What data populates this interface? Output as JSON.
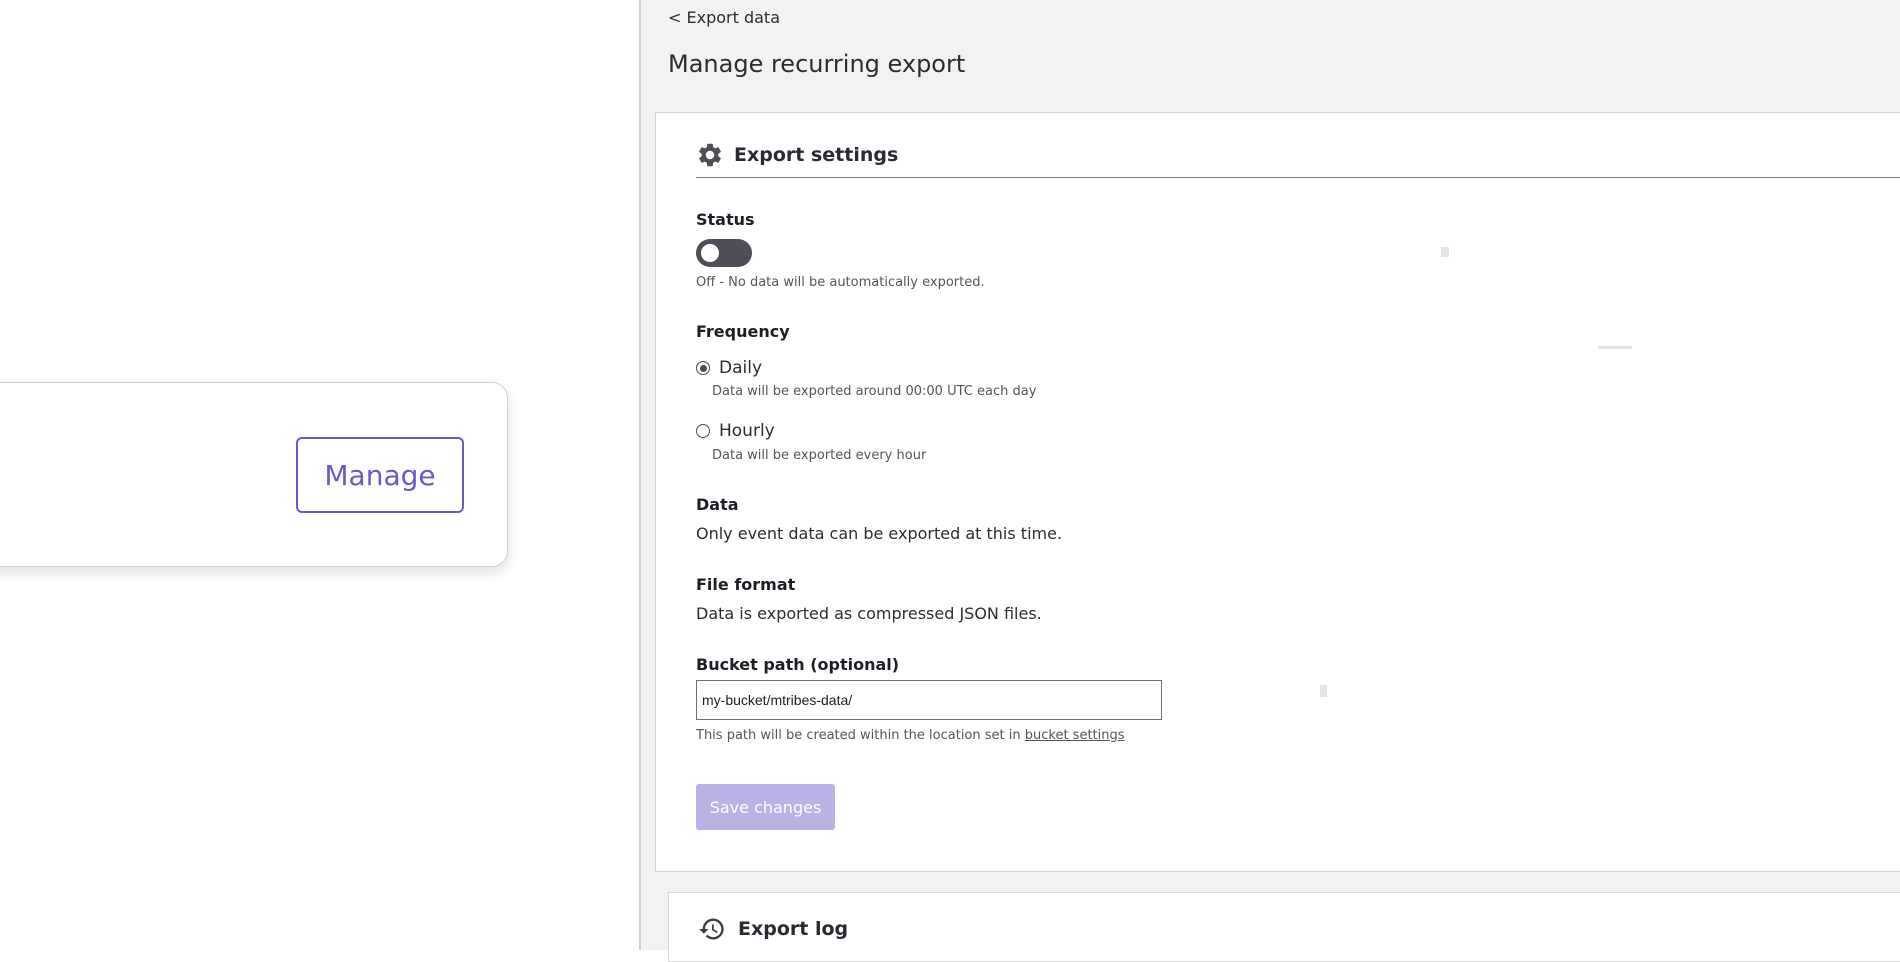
{
  "left_card": {
    "manage_label": "Manage"
  },
  "header": {
    "back_link": "< Export data",
    "page_title": "Manage recurring export"
  },
  "export_settings": {
    "title": "Export settings",
    "icon": "gear-icon",
    "status": {
      "label": "Status",
      "toggle_on": false,
      "description": "Off - No data will be automatically exported."
    },
    "frequency": {
      "label": "Frequency",
      "options": [
        {
          "label": "Daily",
          "hint": "Data will be exported around 00:00 UTC each day",
          "selected": true
        },
        {
          "label": "Hourly",
          "hint": "Data will be exported every hour",
          "selected": false
        }
      ]
    },
    "data": {
      "label": "Data",
      "text": "Only event data can be exported at this time."
    },
    "file_format": {
      "label": "File format",
      "text": "Data is exported as compressed JSON files."
    },
    "bucket_path": {
      "label": "Bucket path (optional)",
      "value": "my-bucket/mtribes-data/",
      "hint_prefix": "This path will be created within the location set in ",
      "hint_link": "bucket settings"
    },
    "save_label": "Save changes"
  },
  "export_log": {
    "title": "Export log",
    "icon": "history-icon"
  },
  "colors": {
    "accent": "#6a5ac8",
    "save_disabled": "#b9b2e4",
    "toggle_off": "#4f5057",
    "panel_bg": "#f2f2f2"
  }
}
